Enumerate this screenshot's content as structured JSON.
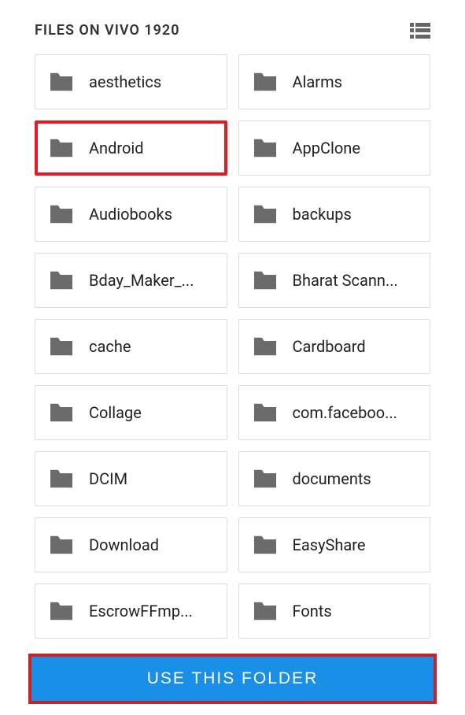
{
  "header": {
    "title": "FILES ON VIVO 1920"
  },
  "folders": [
    {
      "label": "aesthetics",
      "highlighted": false
    },
    {
      "label": "Alarms",
      "highlighted": false
    },
    {
      "label": "Android",
      "highlighted": true
    },
    {
      "label": "AppClone",
      "highlighted": false
    },
    {
      "label": "Audiobooks",
      "highlighted": false
    },
    {
      "label": "backups",
      "highlighted": false
    },
    {
      "label": "Bday_Maker_...",
      "highlighted": false
    },
    {
      "label": "Bharat Scann...",
      "highlighted": false
    },
    {
      "label": "cache",
      "highlighted": false
    },
    {
      "label": "Cardboard",
      "highlighted": false
    },
    {
      "label": "Collage",
      "highlighted": false
    },
    {
      "label": "com.faceboo...",
      "highlighted": false
    },
    {
      "label": "DCIM",
      "highlighted": false
    },
    {
      "label": "documents",
      "highlighted": false
    },
    {
      "label": "Download",
      "highlighted": false
    },
    {
      "label": "EasyShare",
      "highlighted": false
    },
    {
      "label": "EscrowFFmp...",
      "highlighted": false
    },
    {
      "label": "Fonts",
      "highlighted": false
    }
  ],
  "action": {
    "label": "USE THIS FOLDER"
  }
}
